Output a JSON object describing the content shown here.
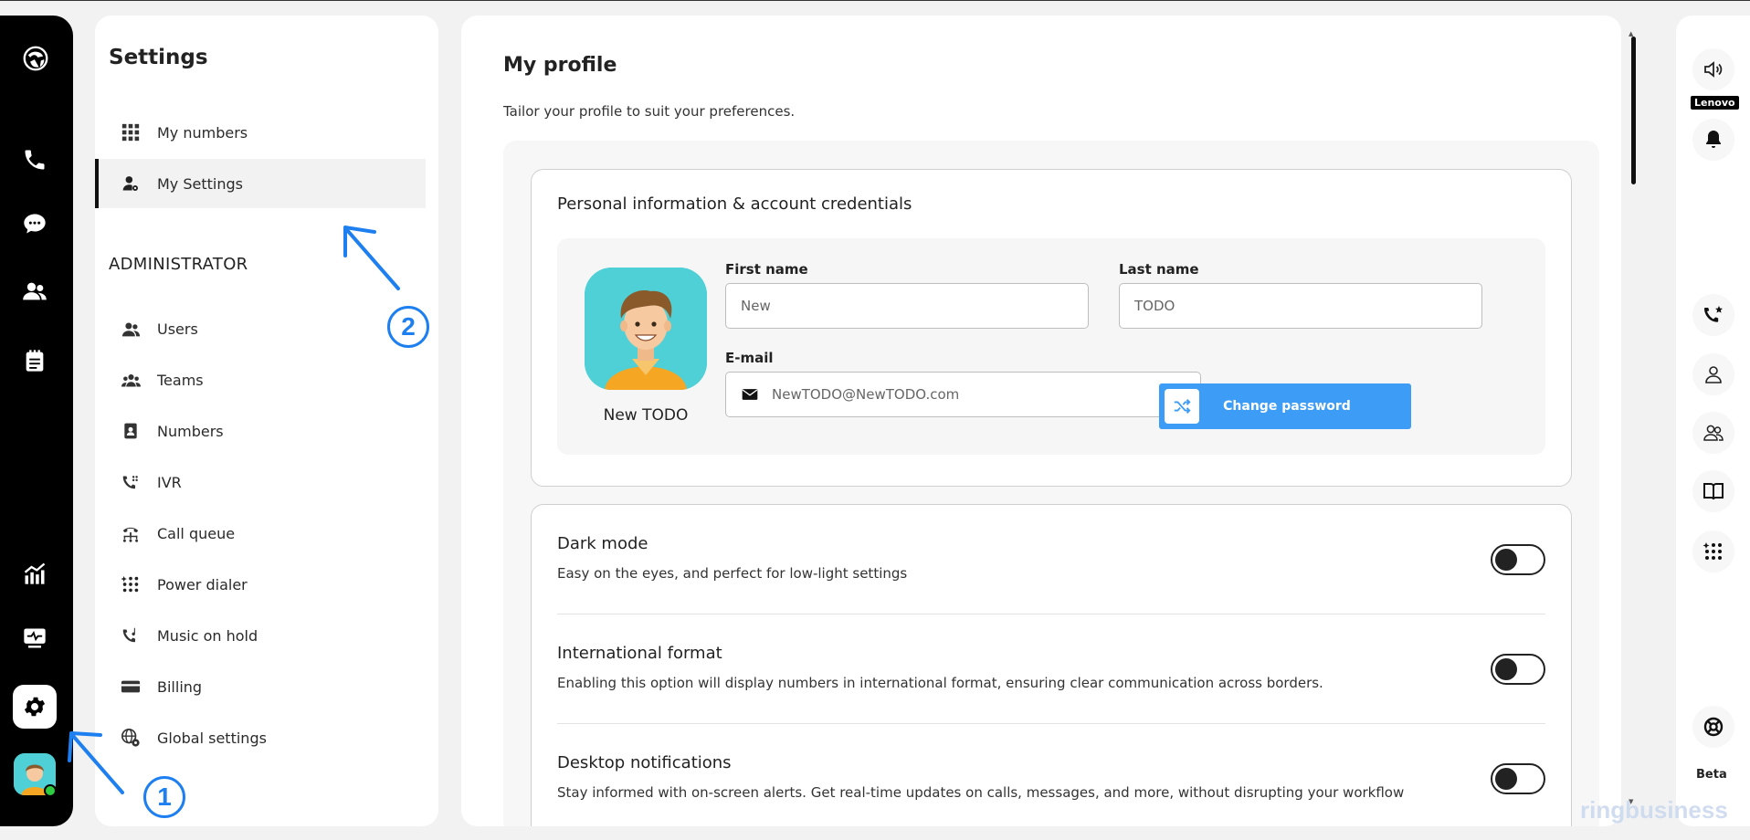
{
  "settings": {
    "title": "Settings",
    "items": [
      {
        "label": "My numbers"
      },
      {
        "label": "My Settings"
      }
    ],
    "admin_title": "ADMINISTRATOR",
    "admin_items": [
      {
        "label": "Users"
      },
      {
        "label": "Teams"
      },
      {
        "label": "Numbers"
      },
      {
        "label": "IVR"
      },
      {
        "label": "Call queue"
      },
      {
        "label": "Power dialer"
      },
      {
        "label": "Music on hold"
      },
      {
        "label": "Billing"
      },
      {
        "label": "Global settings"
      }
    ]
  },
  "profile": {
    "title": "My profile",
    "subtitle": "Tailor your profile to suit your preferences.",
    "personal_title": "Personal information & account credentials",
    "user_name": "New TODO",
    "first_name_label": "First name",
    "first_name_value": "New",
    "last_name_label": "Last name",
    "last_name_value": "TODO",
    "email_label": "E-mail",
    "email_value": "NewTODO@NewTODO.com",
    "change_password_label": "Change password"
  },
  "preferences": [
    {
      "title": "Dark mode",
      "description": "Easy on the eyes, and perfect for low-light settings",
      "enabled": false
    },
    {
      "title": "International format",
      "description": "Enabling this option will display numbers in international format, ensuring clear communication across borders.",
      "enabled": false
    },
    {
      "title": "Desktop notifications",
      "description": "Stay informed with on-screen alerts. Get real-time updates on calls, messages, and more, without disrupting your workflow",
      "enabled": false
    }
  ],
  "right_rail": {
    "device_label": "Lenovo",
    "beta_label": "Beta"
  },
  "annotations": {
    "marker_1": "1",
    "marker_2": "2"
  },
  "watermark": "ringbusiness",
  "colors": {
    "accent": "#3d9cf5",
    "annotation": "#1e7ff0",
    "rail": "#000000",
    "avatar_bg": "#4fd0d6"
  },
  "icons": {
    "rail": [
      "logo-icon",
      "phone-icon",
      "chat-icon",
      "contacts-icon",
      "notes-icon",
      "analytics-icon",
      "monitor-icon",
      "gear-icon"
    ],
    "right_rail": [
      "speaker-icon",
      "bell-icon",
      "phone-star-icon",
      "person-icon",
      "group-icon",
      "book-icon",
      "dialer-icon",
      "help-icon"
    ]
  }
}
